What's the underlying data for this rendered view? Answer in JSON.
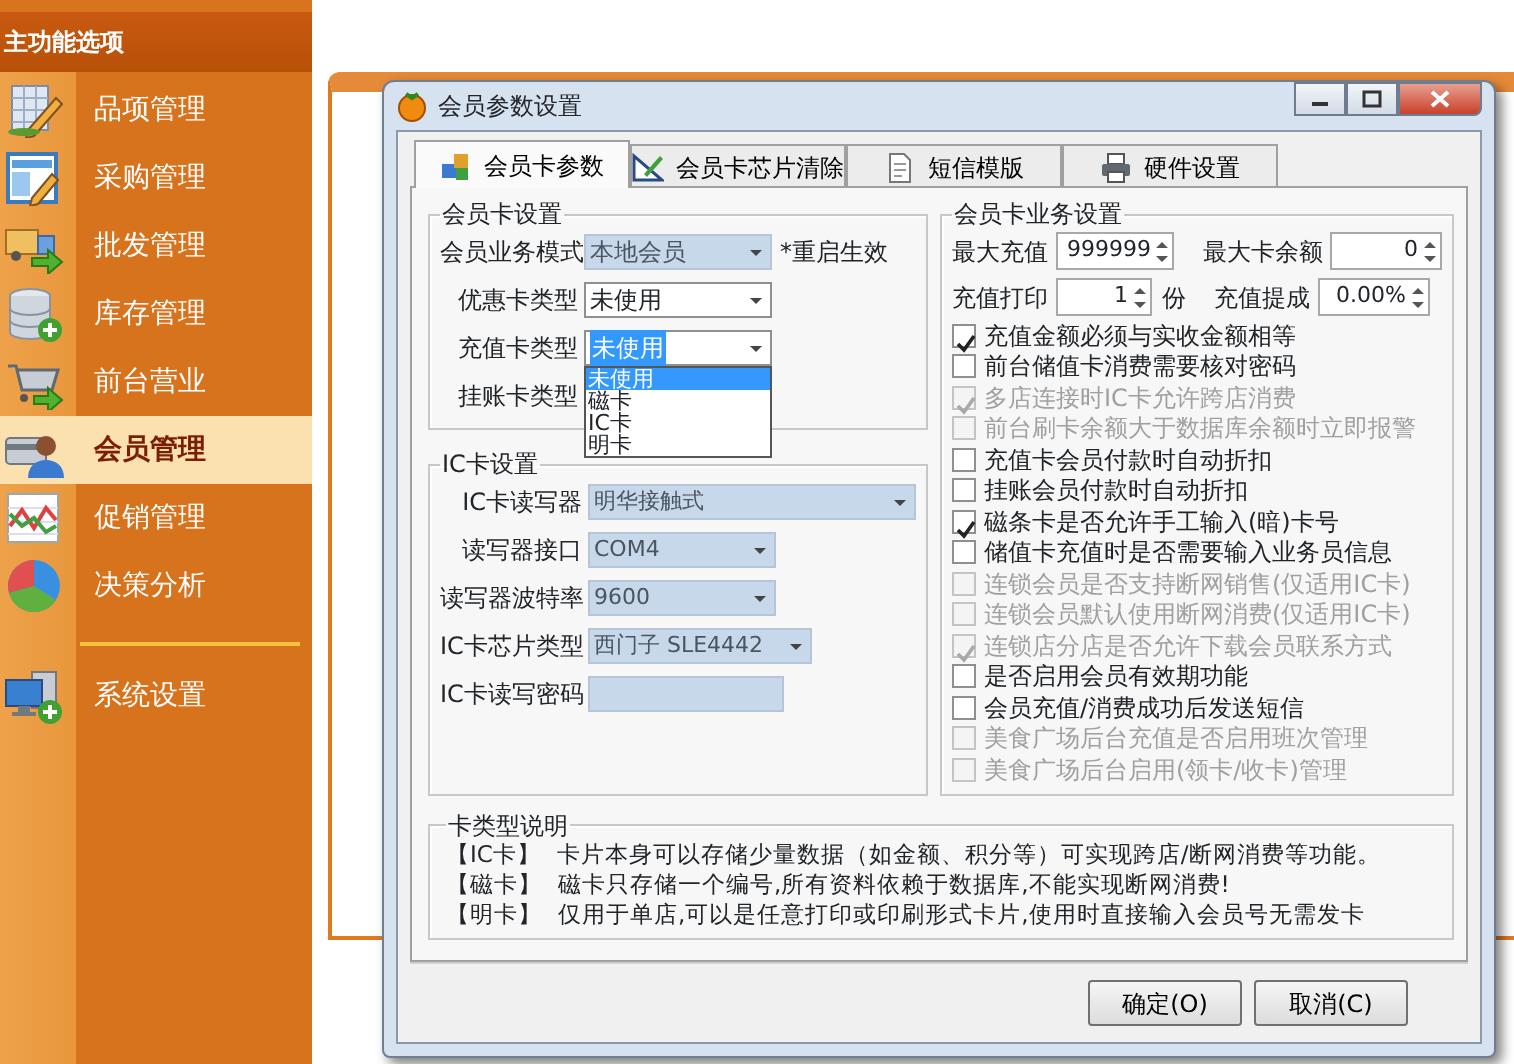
{
  "sidebar": {
    "title": "主功能选项",
    "items": [
      {
        "label": "品项管理",
        "selected": false
      },
      {
        "label": "采购管理",
        "selected": false
      },
      {
        "label": "批发管理",
        "selected": false
      },
      {
        "label": "库存管理",
        "selected": false
      },
      {
        "label": "前台营业",
        "selected": false
      },
      {
        "label": "会员管理",
        "selected": true
      },
      {
        "label": "促销管理",
        "selected": false
      },
      {
        "label": "决策分析",
        "selected": false
      }
    ],
    "footer_items": [
      {
        "label": "系统设置",
        "selected": false
      }
    ]
  },
  "dialog": {
    "title": "会员参数设置",
    "tabs": [
      {
        "label": "会员卡参数",
        "selected": true
      },
      {
        "label": "会员卡芯片清除",
        "selected": false
      },
      {
        "label": "短信模版",
        "selected": false
      },
      {
        "label": "硬件设置",
        "selected": false
      }
    ],
    "card_settings": {
      "title": "会员卡设置",
      "fields": [
        {
          "kind": "select",
          "label": "会员业务模式",
          "value": "本地会员",
          "disabled": true,
          "note": "*重启生效"
        },
        {
          "kind": "select",
          "label": "优惠卡类型",
          "value": "未使用",
          "disabled": false
        },
        {
          "kind": "select",
          "label": "充值卡类型",
          "value": "未使用",
          "disabled": false,
          "focused": true,
          "expanded": true,
          "options": [
            {
              "label": "未使用",
              "selected": true
            },
            {
              "label": "磁卡",
              "selected": false
            },
            {
              "label": "IC卡",
              "selected": false
            },
            {
              "label": "明卡",
              "selected": false
            }
          ]
        },
        {
          "kind": "select",
          "label": "挂账卡类型",
          "disabled": false
        }
      ]
    },
    "ic_settings": {
      "title": "IC卡设置",
      "fields": [
        {
          "kind": "select",
          "label": "IC卡读写器",
          "value": "明华接触式",
          "disabled": true
        },
        {
          "kind": "select",
          "label": "读写器接口",
          "value": "COM4",
          "disabled": true
        },
        {
          "kind": "select",
          "label": "读写器波特率",
          "value": "9600",
          "disabled": true
        },
        {
          "kind": "select",
          "label": "IC卡芯片类型",
          "value": "西门子 SLE4442",
          "disabled": true
        },
        {
          "kind": "text",
          "label": "IC卡读写密码",
          "disabled": true
        }
      ]
    },
    "business_settings": {
      "title": "会员卡业务设置",
      "spin_rows": [
        [
          {
            "label": "最大充值",
            "value": "999999"
          },
          {
            "label": "最大卡余额",
            "value": "0"
          }
        ],
        [
          {
            "label": "充值打印",
            "value": "1",
            "suffix": "份"
          },
          {
            "label": "充值提成",
            "value": "0.00%"
          }
        ]
      ],
      "checkboxes": [
        {
          "label": "充值金额必须与实收金额相等",
          "checked": true,
          "disabled": false
        },
        {
          "label": "前台储值卡消费需要核对密码",
          "checked": false,
          "disabled": false
        },
        {
          "label": "多店连接时IC卡允许跨店消费",
          "checked": true,
          "disabled": true
        },
        {
          "label": "前台刷卡余额大于数据库余额时立即报警",
          "checked": false,
          "disabled": true
        },
        {
          "label": "充值卡会员付款时自动折扣",
          "checked": false,
          "disabled": false
        },
        {
          "label": "挂账会员付款时自动折扣",
          "checked": false,
          "disabled": false
        },
        {
          "label": "磁条卡是否允许手工输入(暗)卡号",
          "checked": true,
          "disabled": false
        },
        {
          "label": "储值卡充值时是否需要输入业务员信息",
          "checked": false,
          "disabled": false
        },
        {
          "label": "连锁会员是否支持断网销售(仅适用IC卡)",
          "checked": false,
          "disabled": true
        },
        {
          "label": "连锁会员默认使用断网消费(仅适用IC卡)",
          "checked": false,
          "disabled": true
        },
        {
          "label": "连锁店分店是否允许下载会员联系方式",
          "checked": true,
          "disabled": true
        },
        {
          "label": "是否启用会员有效期功能",
          "checked": false,
          "disabled": false
        },
        {
          "label": "会员充值/消费成功后发送短信",
          "checked": false,
          "disabled": false
        },
        {
          "label": "美食广场后台充值是否启用班次管理",
          "checked": false,
          "disabled": true
        },
        {
          "label": "美食广场后台启用(领卡/收卡)管理",
          "checked": false,
          "disabled": true
        }
      ]
    },
    "description": {
      "title": "卡类型说明",
      "lines": [
        {
          "tag": "【IC卡】",
          "text": "卡片本身可以存储少量数据（如金额、积分等）可实现跨店/断网消费等功能。"
        },
        {
          "tag": "【磁卡】",
          "text": "磁卡只存储一个编号,所有资料依赖于数据库,不能实现断网消费!"
        },
        {
          "tag": "【明卡】",
          "text": "仅用于单店,可以是任意打印或印刷形式卡片,使用时直接输入会员号无需发卡"
        }
      ]
    },
    "buttons": [
      {
        "label": "确定(O)"
      },
      {
        "label": "取消(C)"
      }
    ]
  }
}
